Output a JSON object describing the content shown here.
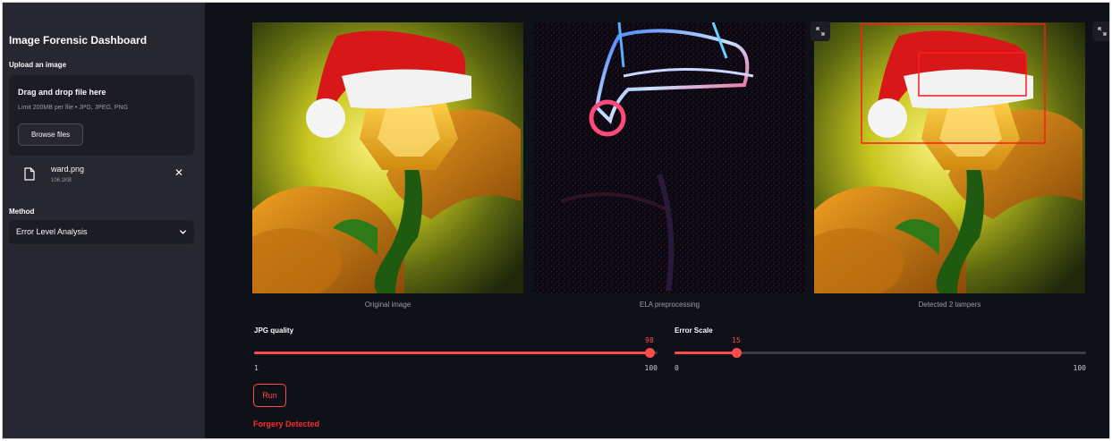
{
  "sidebar": {
    "title": "Image Forensic Dashboard",
    "upload_label": "Upload an image",
    "dropzone": {
      "title": "Drag and drop file here",
      "subtitle": "Limit 200MB per file • JPG, JPEG, PNG",
      "browse_label": "Browse files"
    },
    "file": {
      "name": "ward.png",
      "size": "106.1KB"
    },
    "method_label": "Method",
    "method_value": "Error Level Analysis"
  },
  "images": [
    {
      "caption": "Original image"
    },
    {
      "caption": "ELA preprocessing"
    },
    {
      "caption": "Detected 2 tampers"
    }
  ],
  "sliders": {
    "jpg_quality": {
      "label": "JPG quality",
      "value": "98",
      "min": "1",
      "max": "100",
      "value_num": 98,
      "min_num": 1,
      "max_num": 100
    },
    "error_scale": {
      "label": "Error Scale",
      "value": "15",
      "min": "0",
      "max": "100",
      "value_num": 15,
      "min_num": 0,
      "max_num": 100
    }
  },
  "run_label": "Run",
  "result_text": "Forgery Detected",
  "colors": {
    "accent": "#ff4b4b",
    "background": "#0e1117",
    "sidebar": "#262730"
  },
  "icons": [
    "file-icon",
    "close-icon",
    "chevron-down-icon",
    "expand-icon"
  ]
}
